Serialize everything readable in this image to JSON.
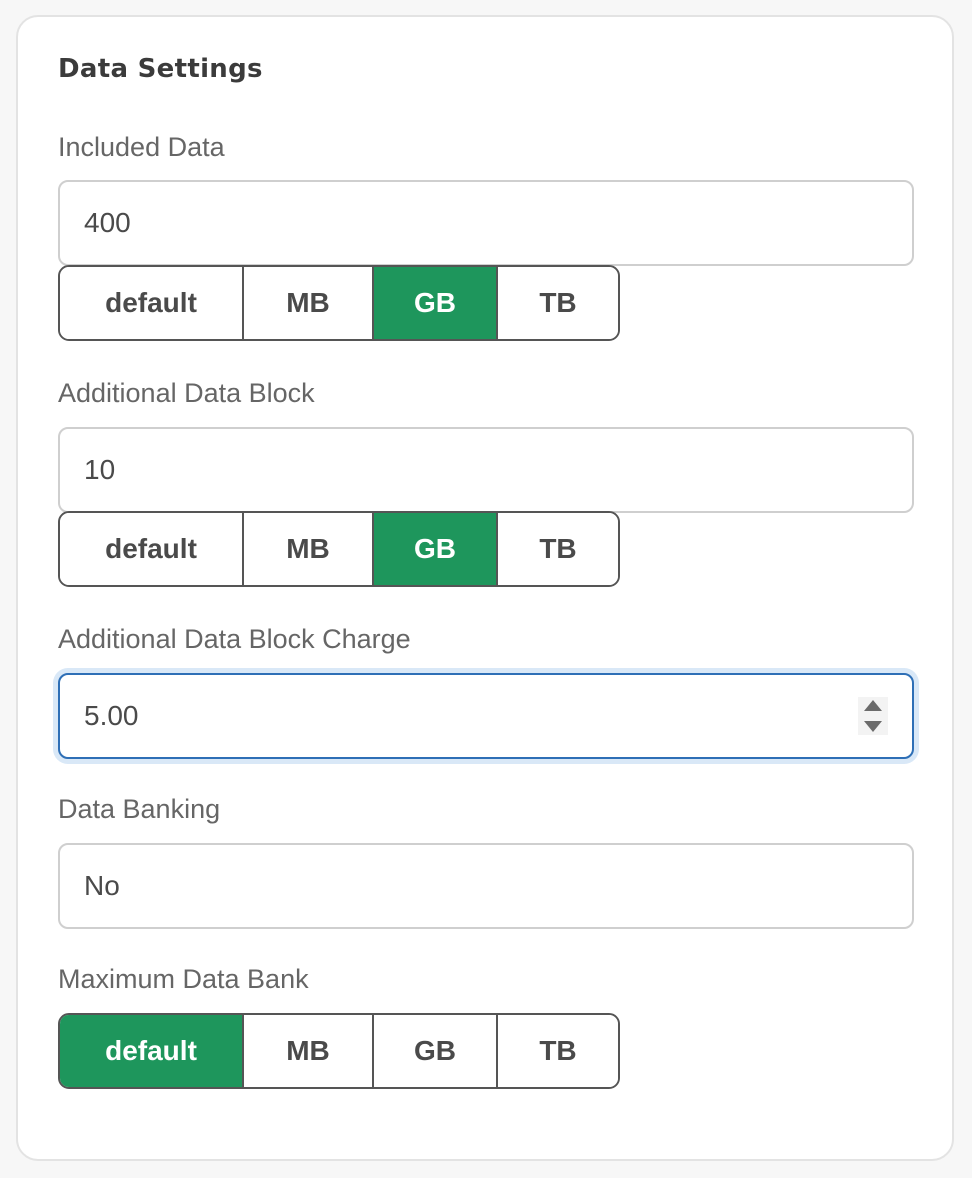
{
  "section": {
    "title": "Data Settings"
  },
  "included_data": {
    "label": "Included Data",
    "value": "400",
    "units": [
      "default",
      "MB",
      "GB",
      "TB"
    ],
    "selected_unit": "GB"
  },
  "additional_data_block": {
    "label": "Additional Data Block",
    "value": "10",
    "units": [
      "default",
      "MB",
      "GB",
      "TB"
    ],
    "selected_unit": "GB"
  },
  "additional_data_block_charge": {
    "label": "Additional Data Block Charge",
    "value": "5.00"
  },
  "data_banking": {
    "label": "Data Banking",
    "value": "No"
  },
  "maximum_data_bank": {
    "label": "Maximum Data Bank",
    "units": [
      "default",
      "MB",
      "GB",
      "TB"
    ],
    "selected_unit": "default"
  },
  "colors": {
    "active_segment": "#1e965c",
    "focus_border": "#2e6fb6"
  },
  "icons": {
    "number_spinner": "spinner-arrows-icon"
  }
}
